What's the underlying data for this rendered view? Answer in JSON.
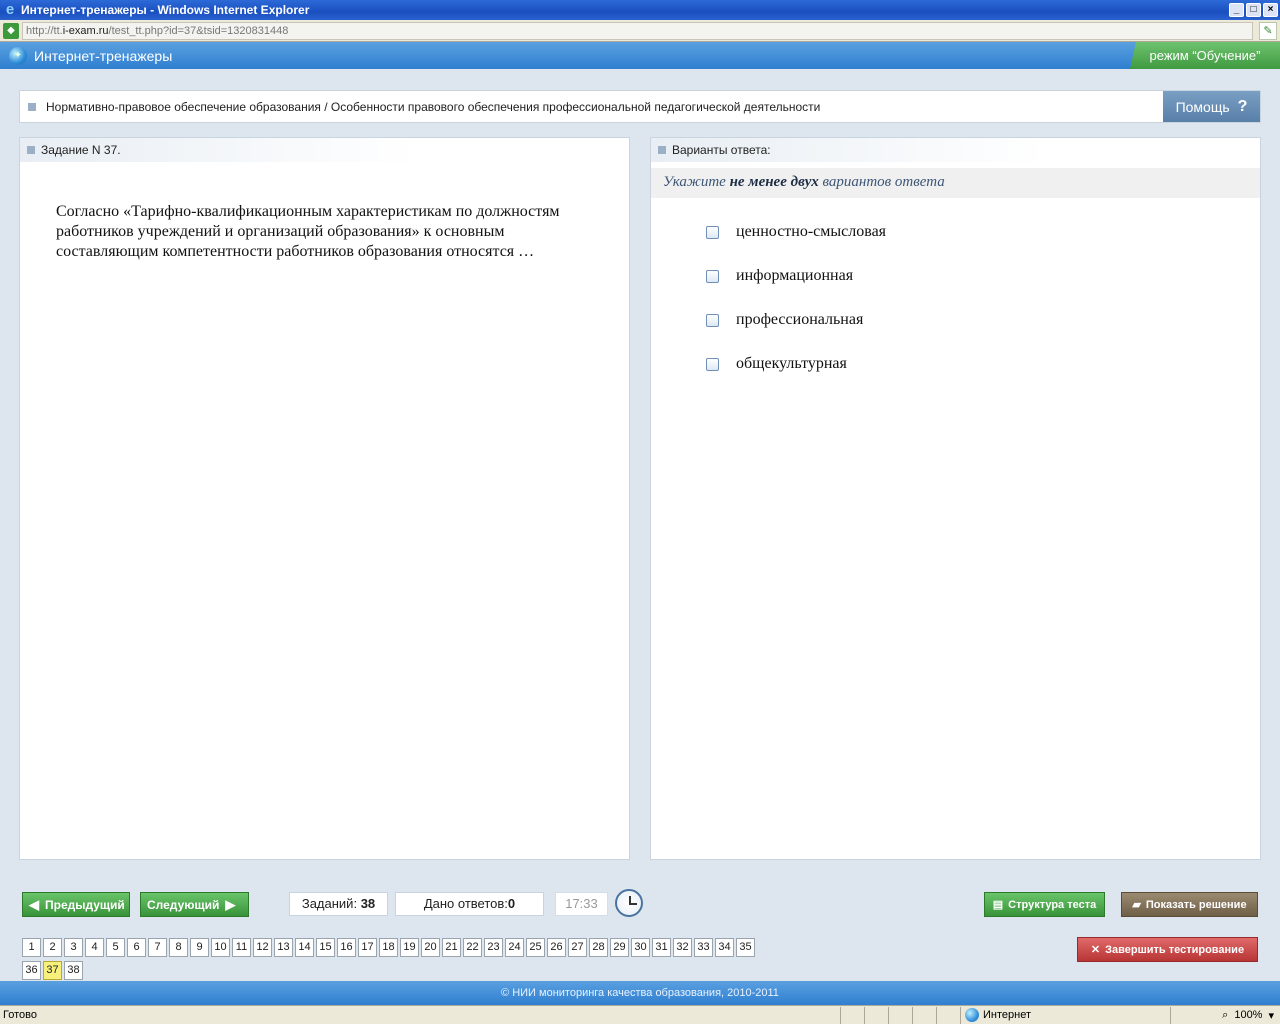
{
  "window": {
    "title": "Интернет-тренажеры - Windows Internet Explorer",
    "buttons": [
      "_",
      "□",
      "×"
    ]
  },
  "address": {
    "url_prefix": "http://tt.",
    "url_host": "i-exam.ru",
    "url_rest": "/test_tt.php?id=37&tsid=1320831448"
  },
  "app": {
    "name": "Интернет-тренажеры",
    "mode": "режим “Обучение”"
  },
  "breadcrumb": {
    "text": "Нормативно-правовое обеспечение образования / Особенности правового обеспечения профессиональной педагогической деятельности",
    "help_label": "Помощь",
    "help_icon": "?"
  },
  "task": {
    "header": "Задание N 37.",
    "question": "Согласно «Тарифно-квалификационным характеристикам по должностям работников учреждений и организаций образования» к основным составляющим компетентности работников образования относятся …"
  },
  "answers": {
    "header": "Варианты ответа:",
    "hint_before": "Укажите",
    "hint_bold": "не менее двух",
    "hint_after": "вариантов ответа",
    "options": [
      "ценностно-смысловая",
      "информационная",
      "профессиональная",
      "общекультурная"
    ]
  },
  "nav": {
    "prev_label": "Предыдущий",
    "next_label": "Следующий",
    "tasks_label": "Заданий:",
    "tasks_count": "38",
    "answers_label": "Дано ответов:",
    "answers_count": "0",
    "timer": "17:33",
    "structure_label": "Структура теста",
    "solution_label": "Показать решение",
    "finish_label": "Завершить тестирование"
  },
  "pages": [
    "1",
    "2",
    "3",
    "4",
    "5",
    "6",
    "7",
    "8",
    "9",
    "10",
    "11",
    "12",
    "13",
    "14",
    "15",
    "16",
    "17",
    "18",
    "19",
    "20",
    "21",
    "22",
    "23",
    "24",
    "25",
    "26",
    "27",
    "28",
    "29",
    "30",
    "31",
    "32",
    "33",
    "34",
    "35",
    "36",
    "37",
    "38"
  ],
  "current_page": "37",
  "footer": "© НИИ мониторинга качества образования, 2010-2011",
  "status": {
    "left": "Готово",
    "zone": "Интернет",
    "zoom": "100%"
  }
}
